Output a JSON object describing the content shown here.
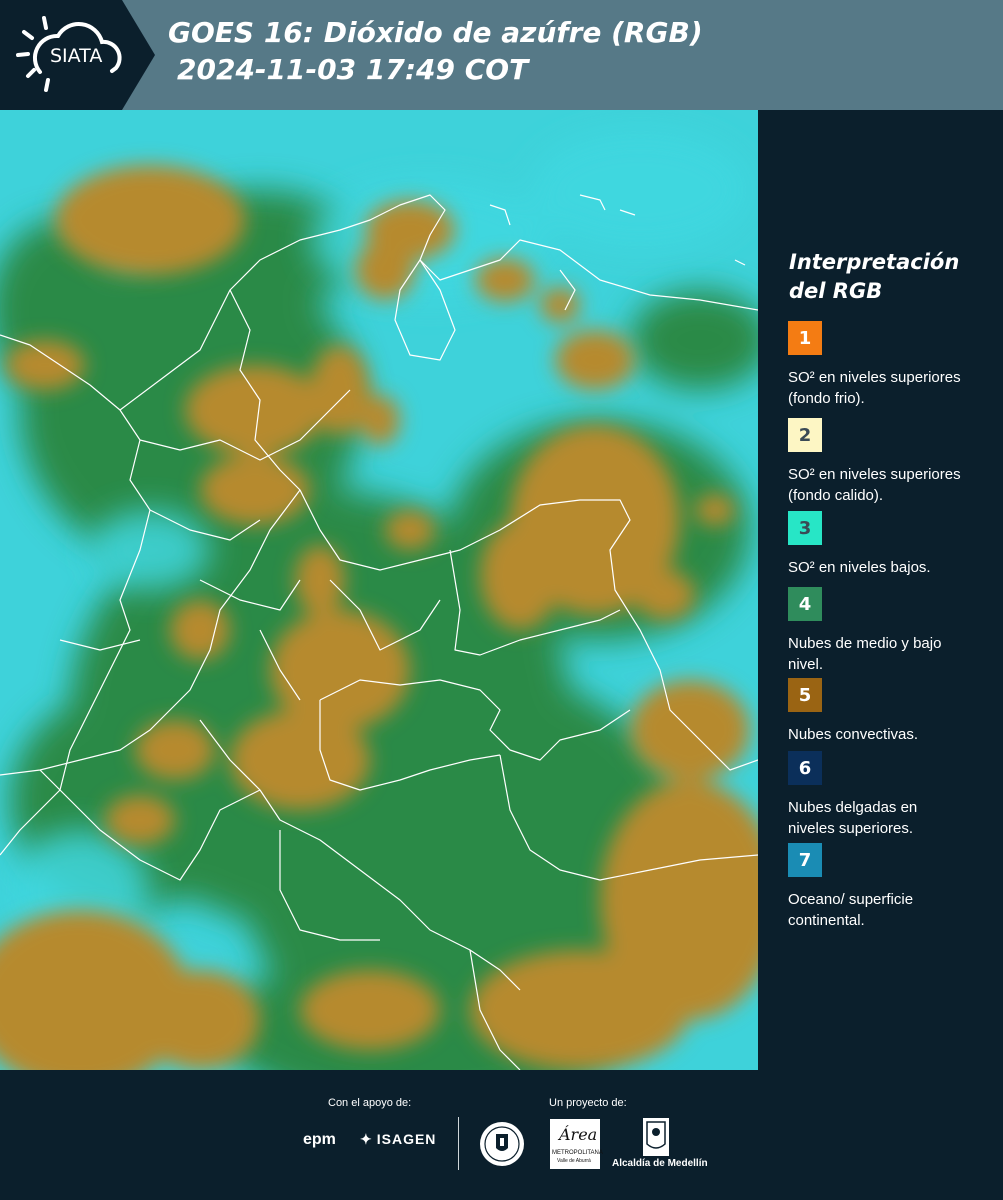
{
  "header": {
    "brand": "SIATA",
    "title_line1": "GOES 16: Dióxido de azúfre (RGB)",
    "title_line2": "2024-11-03 17:49 COT"
  },
  "legend": {
    "title": "Interpretación del RGB",
    "items": [
      {
        "number": "1",
        "color": "#f47c13",
        "text": "SO² en niveles superiores (fondo frio)."
      },
      {
        "number": "2",
        "color": "#fdf6c4",
        "text": "SO² en niveles superiores (fondo calido)."
      },
      {
        "number": "3",
        "color": "#27e6c6",
        "text": "SO² en niveles bajos."
      },
      {
        "number": "4",
        "color": "#2f8c5c",
        "text": "Nubes de medio y bajo nivel."
      },
      {
        "number": "5",
        "color": "#9a6413",
        "text": "Nubes convectivas."
      },
      {
        "number": "6",
        "color": "#0b2f5a",
        "text": "Nubes delgadas en niveles superiores."
      },
      {
        "number": "7",
        "color": "#1a8cb4",
        "text": "Oceano/ superficie continental."
      }
    ]
  },
  "footer": {
    "support_label": "Con el apoyo de:",
    "project_label": "Un proyecto de:",
    "logo_epm": "epm",
    "logo_isagen": "ISAGEN",
    "logo_area_main": "Área",
    "logo_area_sub": "METROPOLITANA",
    "logo_area_sub2": "Valle de Aburrá",
    "logo_alcaldia": "Alcaldía de Medellín"
  },
  "colors": {
    "header_bg": "#567987",
    "panel_bg": "#0b1f2c",
    "cloud_orange": "#b88a2c",
    "ground_green": "#2f8c4a",
    "sky_cyan": "#3fd8e0"
  }
}
